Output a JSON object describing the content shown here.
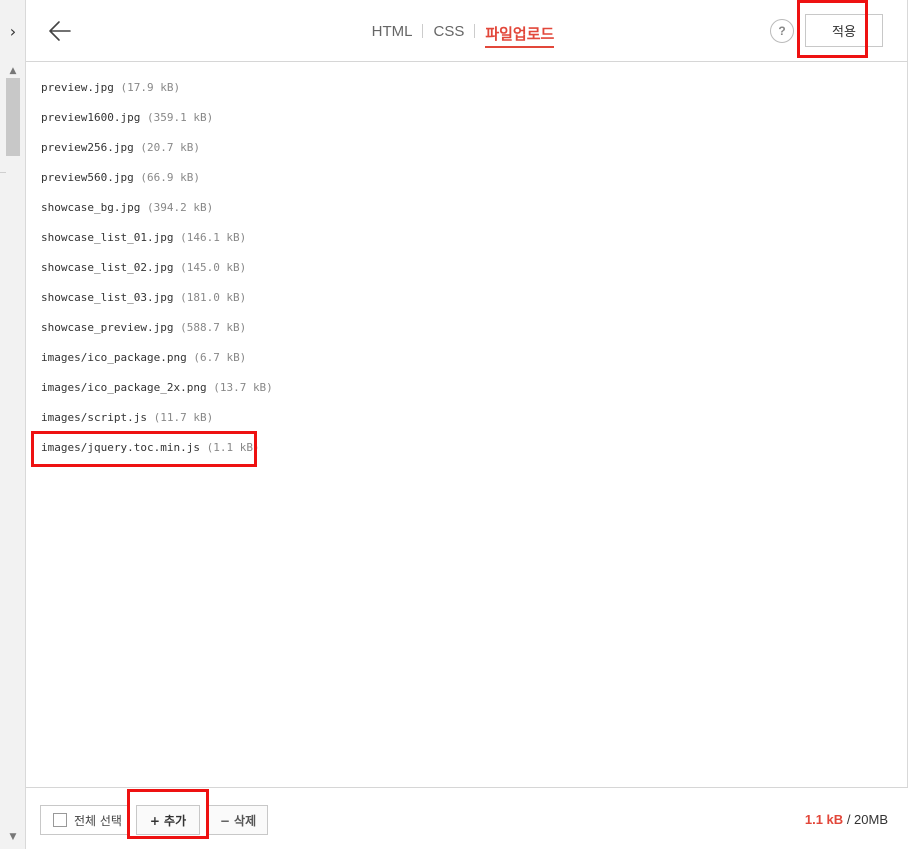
{
  "sidebar": {
    "expand_icon": "chevron-right-icon",
    "expand_glyph": "›"
  },
  "header": {
    "back_icon": "arrow-left-icon",
    "tabs": [
      {
        "label": "HTML"
      },
      {
        "label": "CSS"
      },
      {
        "label": "파일업로드",
        "active": true
      }
    ],
    "help_label": "?",
    "apply_label": "적용"
  },
  "files": [
    {
      "name": "preview.jpg",
      "size": "(17.9 kB)"
    },
    {
      "name": "preview1600.jpg",
      "size": "(359.1 kB)"
    },
    {
      "name": "preview256.jpg",
      "size": "(20.7 kB)"
    },
    {
      "name": "preview560.jpg",
      "size": "(66.9 kB)"
    },
    {
      "name": "showcase_bg.jpg",
      "size": "(394.2 kB)"
    },
    {
      "name": "showcase_list_01.jpg",
      "size": "(146.1 kB)"
    },
    {
      "name": "showcase_list_02.jpg",
      "size": "(145.0 kB)"
    },
    {
      "name": "showcase_list_03.jpg",
      "size": "(181.0 kB)"
    },
    {
      "name": "showcase_preview.jpg",
      "size": "(588.7 kB)"
    },
    {
      "name": "images/ico_package.png",
      "size": "(6.7 kB)"
    },
    {
      "name": "images/ico_package_2x.png",
      "size": "(13.7 kB)"
    },
    {
      "name": "images/script.js",
      "size": "(11.7 kB)"
    },
    {
      "name": "images/jquery.toc.min.js",
      "size": "(1.1 kB)"
    }
  ],
  "footer": {
    "select_all_label": "전체 선택",
    "add_label": "+ 추가",
    "delete_label": "− 삭제",
    "storage_used": "1.1 kB",
    "storage_total": "/ 20MB"
  },
  "colors": {
    "accent": "#e2473a",
    "highlight": "#ee1111"
  }
}
